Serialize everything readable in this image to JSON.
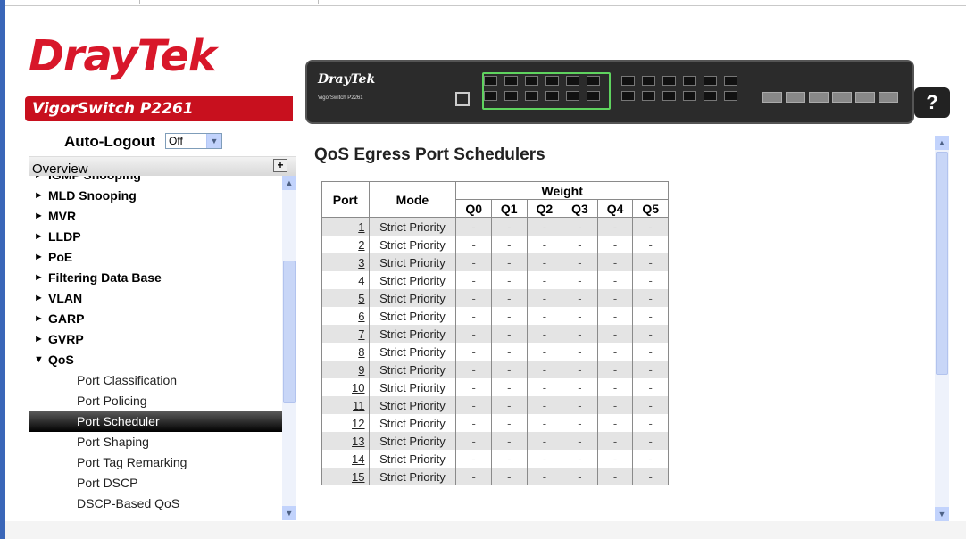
{
  "brand": {
    "logo_text": "DrayTek",
    "model_name": "VigorSwitch P2261",
    "device_logo": "DrayTek",
    "device_model": "VigorSwitch P2261"
  },
  "help_label": "?",
  "auto_logout": {
    "label": "Auto-Logout",
    "value": "Off"
  },
  "overview_label": "Overview",
  "nav": [
    {
      "label": "IGMP Snooping",
      "kind": "top"
    },
    {
      "label": "MLD Snooping",
      "kind": "top"
    },
    {
      "label": "MVR",
      "kind": "top"
    },
    {
      "label": "LLDP",
      "kind": "top"
    },
    {
      "label": "PoE",
      "kind": "top"
    },
    {
      "label": "Filtering Data Base",
      "kind": "top"
    },
    {
      "label": "VLAN",
      "kind": "top"
    },
    {
      "label": "GARP",
      "kind": "top"
    },
    {
      "label": "GVRP",
      "kind": "top"
    },
    {
      "label": "QoS",
      "kind": "top",
      "expanded": true
    },
    {
      "label": "Port Classification",
      "kind": "sub"
    },
    {
      "label": "Port Policing",
      "kind": "sub"
    },
    {
      "label": "Port Scheduler",
      "kind": "sub",
      "selected": true
    },
    {
      "label": "Port Shaping",
      "kind": "sub"
    },
    {
      "label": "Port Tag Remarking",
      "kind": "sub"
    },
    {
      "label": "Port DSCP",
      "kind": "sub"
    },
    {
      "label": "DSCP-Based QoS",
      "kind": "sub"
    }
  ],
  "main": {
    "title": "QoS Egress Port Schedulers",
    "headers": {
      "port": "Port",
      "mode": "Mode",
      "weight": "Weight",
      "queues": [
        "Q0",
        "Q1",
        "Q2",
        "Q3",
        "Q4",
        "Q5"
      ]
    },
    "rows": [
      {
        "port": "1",
        "mode": "Strict Priority",
        "weights": [
          "-",
          "-",
          "-",
          "-",
          "-",
          "-"
        ]
      },
      {
        "port": "2",
        "mode": "Strict Priority",
        "weights": [
          "-",
          "-",
          "-",
          "-",
          "-",
          "-"
        ]
      },
      {
        "port": "3",
        "mode": "Strict Priority",
        "weights": [
          "-",
          "-",
          "-",
          "-",
          "-",
          "-"
        ]
      },
      {
        "port": "4",
        "mode": "Strict Priority",
        "weights": [
          "-",
          "-",
          "-",
          "-",
          "-",
          "-"
        ]
      },
      {
        "port": "5",
        "mode": "Strict Priority",
        "weights": [
          "-",
          "-",
          "-",
          "-",
          "-",
          "-"
        ]
      },
      {
        "port": "6",
        "mode": "Strict Priority",
        "weights": [
          "-",
          "-",
          "-",
          "-",
          "-",
          "-"
        ]
      },
      {
        "port": "7",
        "mode": "Strict Priority",
        "weights": [
          "-",
          "-",
          "-",
          "-",
          "-",
          "-"
        ]
      },
      {
        "port": "8",
        "mode": "Strict Priority",
        "weights": [
          "-",
          "-",
          "-",
          "-",
          "-",
          "-"
        ]
      },
      {
        "port": "9",
        "mode": "Strict Priority",
        "weights": [
          "-",
          "-",
          "-",
          "-",
          "-",
          "-"
        ]
      },
      {
        "port": "10",
        "mode": "Strict Priority",
        "weights": [
          "-",
          "-",
          "-",
          "-",
          "-",
          "-"
        ]
      },
      {
        "port": "11",
        "mode": "Strict Priority",
        "weights": [
          "-",
          "-",
          "-",
          "-",
          "-",
          "-"
        ]
      },
      {
        "port": "12",
        "mode": "Strict Priority",
        "weights": [
          "-",
          "-",
          "-",
          "-",
          "-",
          "-"
        ]
      },
      {
        "port": "13",
        "mode": "Strict Priority",
        "weights": [
          "-",
          "-",
          "-",
          "-",
          "-",
          "-"
        ]
      },
      {
        "port": "14",
        "mode": "Strict Priority",
        "weights": [
          "-",
          "-",
          "-",
          "-",
          "-",
          "-"
        ]
      },
      {
        "port": "15",
        "mode": "Strict Priority",
        "weights": [
          "-",
          "-",
          "-",
          "-",
          "-",
          "-"
        ]
      }
    ]
  },
  "colors": {
    "brand_red": "#c8101e",
    "selected_nav": "#000000",
    "row_alt": "#e4e4e4"
  }
}
